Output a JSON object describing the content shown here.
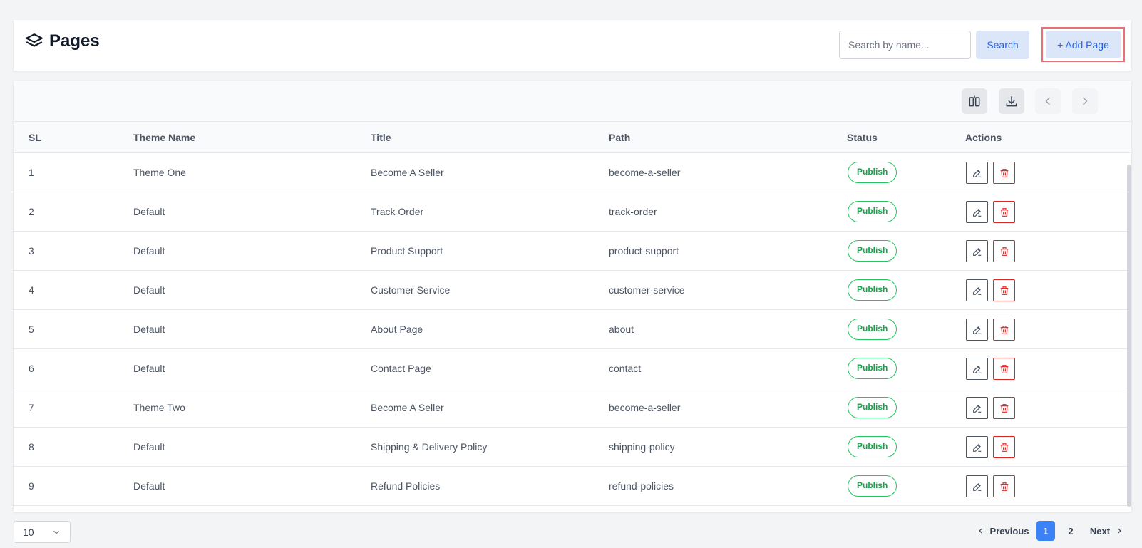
{
  "header": {
    "title": "Pages",
    "search_placeholder": "Search by name...",
    "search_label": "Search",
    "add_label": "+ Add Page"
  },
  "table": {
    "columns": [
      "SL",
      "Theme Name",
      "Title",
      "Path",
      "Status",
      "Actions"
    ],
    "rows": [
      {
        "sl": "1",
        "theme": "Theme One",
        "title": "Become A Seller",
        "path": "become-a-seller",
        "status": "Publish"
      },
      {
        "sl": "2",
        "theme": "Default",
        "title": "Track Order",
        "path": "track-order",
        "status": "Publish"
      },
      {
        "sl": "3",
        "theme": "Default",
        "title": "Product Support",
        "path": "product-support",
        "status": "Publish"
      },
      {
        "sl": "4",
        "theme": "Default",
        "title": "Customer Service",
        "path": "customer-service",
        "status": "Publish"
      },
      {
        "sl": "5",
        "theme": "Default",
        "title": "About Page",
        "path": "about",
        "status": "Publish"
      },
      {
        "sl": "6",
        "theme": "Default",
        "title": "Contact Page",
        "path": "contact",
        "status": "Publish"
      },
      {
        "sl": "7",
        "theme": "Theme Two",
        "title": "Become A Seller",
        "path": "become-a-seller",
        "status": "Publish"
      },
      {
        "sl": "8",
        "theme": "Default",
        "title": "Shipping & Delivery Policy",
        "path": "shipping-policy",
        "status": "Publish"
      },
      {
        "sl": "9",
        "theme": "Default",
        "title": "Refund Policies",
        "path": "refund-policies",
        "status": "Publish"
      }
    ]
  },
  "pagination": {
    "per_page": "10",
    "previous_label": "Previous",
    "pages": [
      "1",
      "2"
    ],
    "current": "1",
    "next_label": "Next"
  },
  "icons": {
    "title": "layers-icon",
    "toolbar": [
      "columns-icon",
      "download-icon",
      "chevron-left-icon",
      "chevron-right-icon"
    ],
    "row_actions": [
      "edit-icon",
      "trash-icon"
    ]
  },
  "colors": {
    "accent": "#3b82f6",
    "status_publish": "#16a34a",
    "delete": "#dc2626"
  }
}
